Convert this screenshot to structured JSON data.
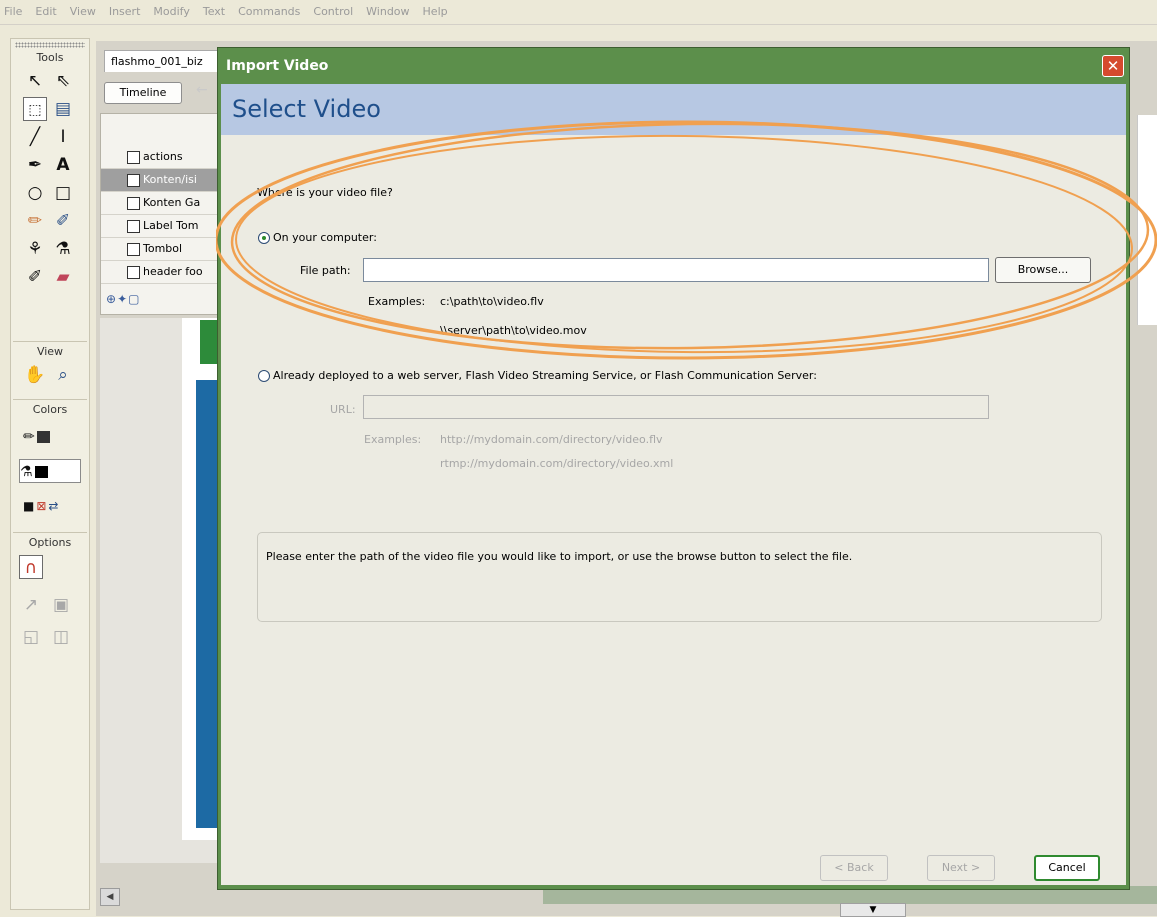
{
  "menubar": {
    "items": [
      "File",
      "Edit",
      "View",
      "Insert",
      "Modify",
      "Text",
      "Commands",
      "Control",
      "Window",
      "Help"
    ]
  },
  "tools_panel": {
    "title": "Tools",
    "view_label": "View",
    "colors_label": "Colors",
    "options_label": "Options"
  },
  "document": {
    "tab_title": "flashmo_001_biz",
    "timeline_label": "Timeline",
    "layers": [
      "actions",
      "Konten/isi",
      "Konten Ga",
      "Label Tom",
      "Tombol",
      "header foo"
    ]
  },
  "dialog": {
    "title": "Import Video",
    "close_glyph": "✕",
    "header": "Select Video",
    "question": "Where is your video file?",
    "option_computer": {
      "label": "On your computer:",
      "selected": true,
      "file_path_label": "File path:",
      "file_path_value": "",
      "browse_label": "Browse...",
      "examples_label": "Examples:",
      "example_1": "c:\\path\\to\\video.flv",
      "example_2": "\\\\server\\path\\to\\video.mov"
    },
    "option_server": {
      "label": "Already deployed to a web server, Flash Video Streaming Service, or Flash Communication Server:",
      "selected": false,
      "url_label": "URL:",
      "url_value": "",
      "examples_label": "Examples:",
      "example_1": "http://mydomain.com/directory/video.flv",
      "example_2": "rtmp://mydomain.com/directory/video.xml"
    },
    "info_text": "Please enter the path of the video file you would like to import, or use the browse button to select the file.",
    "buttons": {
      "back": "< Back",
      "next": "Next >",
      "cancel": "Cancel"
    }
  },
  "colors": {
    "dialog_title_bar": "#5c8f4b",
    "dialog_header_band": "#b7c8e3",
    "annotation_stroke": "#f0a050"
  }
}
